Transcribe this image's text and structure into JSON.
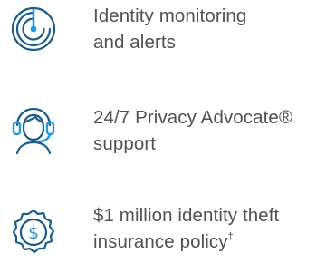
{
  "features": [
    {
      "icon": "radar-icon",
      "line1": "Identity monitoring",
      "line2": "and alerts",
      "mark": ""
    },
    {
      "icon": "headset-agent-icon",
      "line1": "24/7 Privacy Advocate®",
      "line2": "support",
      "mark": ""
    },
    {
      "icon": "dollar-seal-icon",
      "line1": "$1 million identity theft",
      "line2": "insurance policy",
      "mark": "†"
    }
  ],
  "colors": {
    "icon_stroke": "#1a5c8a",
    "accent": "#1f9ad6",
    "text": "#4e5156"
  }
}
